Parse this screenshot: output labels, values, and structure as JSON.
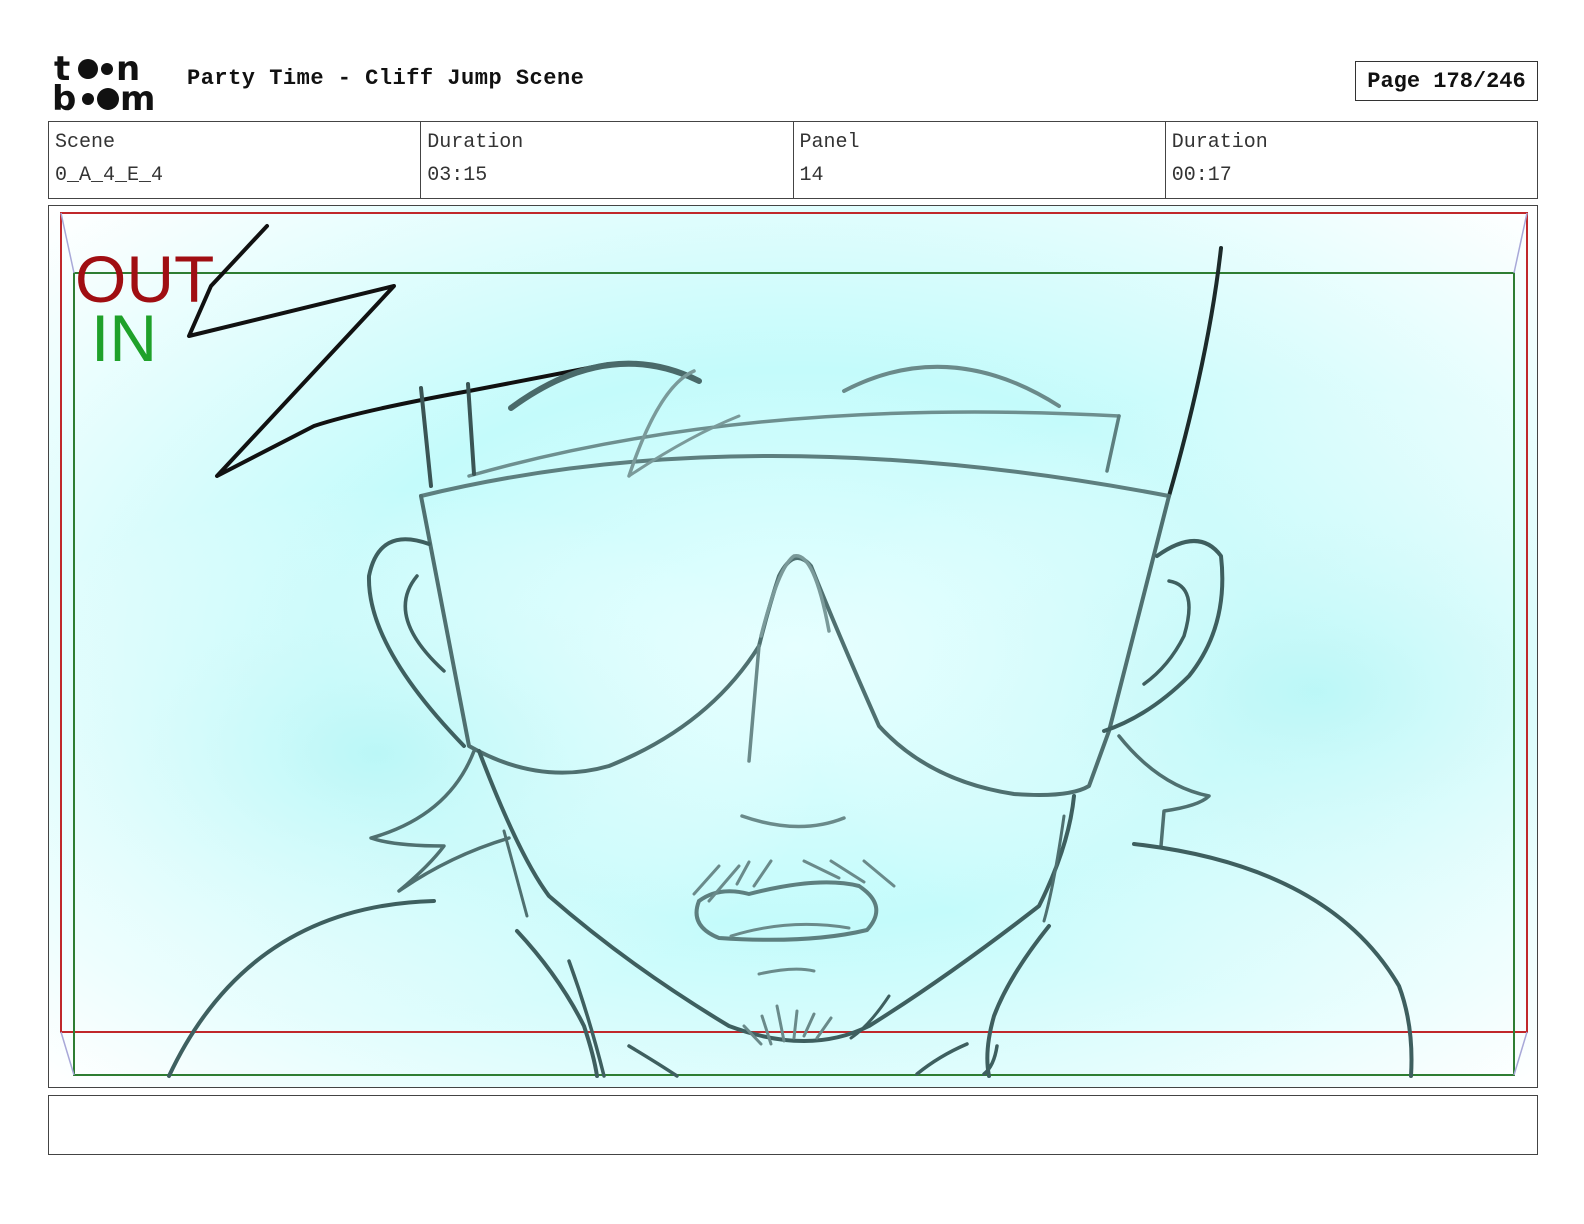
{
  "header": {
    "logo_icon": "toon-boom-logo",
    "project_title": "Party Time - Cliff Jump Scene",
    "page_label": "Page 178/246"
  },
  "info": {
    "scene_label": "Scene",
    "scene_value": "0_A_4_E_4",
    "scene_duration_label": "Duration",
    "scene_duration_value": "03:15",
    "panel_label": "Panel",
    "panel_value": "14",
    "panel_duration_label": "Duration",
    "panel_duration_value": "00:17"
  },
  "panel": {
    "out_label": "OUT",
    "in_label": "IN",
    "colors": {
      "background_tint": "#c4fbfb",
      "out_frame": "#c0282b",
      "in_frame": "#2e7d32",
      "sketch_line": "#3e5f5f"
    }
  },
  "notes": {
    "text": ""
  }
}
